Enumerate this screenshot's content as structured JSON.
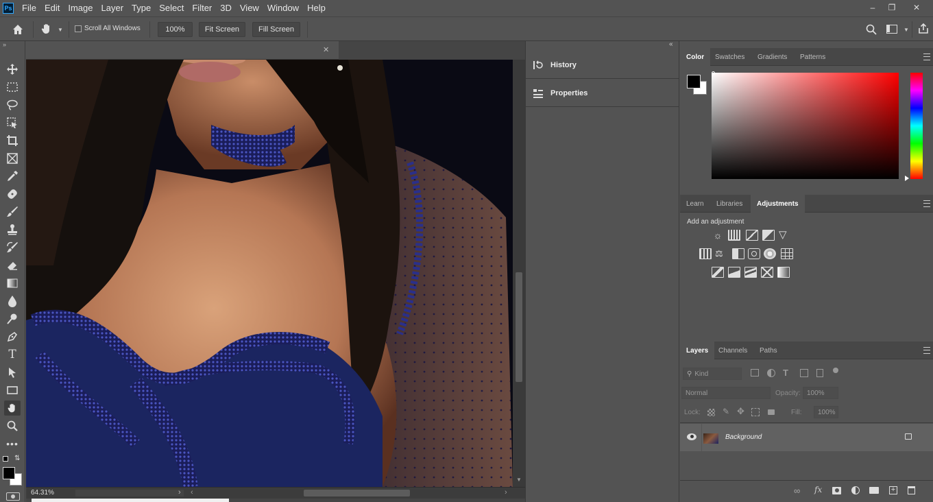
{
  "app": {
    "logo": "Ps"
  },
  "menu": [
    "File",
    "Edit",
    "Image",
    "Layer",
    "Type",
    "Select",
    "Filter",
    "3D",
    "View",
    "Window",
    "Help"
  ],
  "options": {
    "scroll_all_windows": "Scroll All Windows",
    "zoom_100": "100%",
    "fit_screen": "Fit Screen",
    "fill_screen": "Fill Screen"
  },
  "doc": {
    "zoom": "64.31%"
  },
  "mid_panels": {
    "history": "History",
    "properties": "Properties"
  },
  "color_panel": {
    "tabs": [
      "Color",
      "Swatches",
      "Gradients",
      "Patterns"
    ],
    "active": "Color",
    "hue": "#ff0000"
  },
  "adj_panel": {
    "tabs": [
      "Learn",
      "Libraries",
      "Adjustments"
    ],
    "active": "Adjustments",
    "heading": "Add an adjustment"
  },
  "layers_panel": {
    "tabs": [
      "Layers",
      "Channels",
      "Paths"
    ],
    "active": "Layers",
    "kind_placeholder": "Kind",
    "blend_mode": "Normal",
    "opacity_label": "Opacity:",
    "opacity_value": "100%",
    "lock_label": "Lock:",
    "fill_label": "Fill:",
    "fill_value": "100%",
    "layers": [
      {
        "name": "Background",
        "visible": true,
        "locked": true
      }
    ]
  },
  "icons": {
    "home": "home-icon",
    "hand": "hand-icon",
    "search": "search-icon",
    "workspace": "workspace-icon",
    "share": "share-icon"
  },
  "colors": {
    "foreground": "#000000",
    "background": "#ffffff",
    "accent": "#31a8ff"
  }
}
